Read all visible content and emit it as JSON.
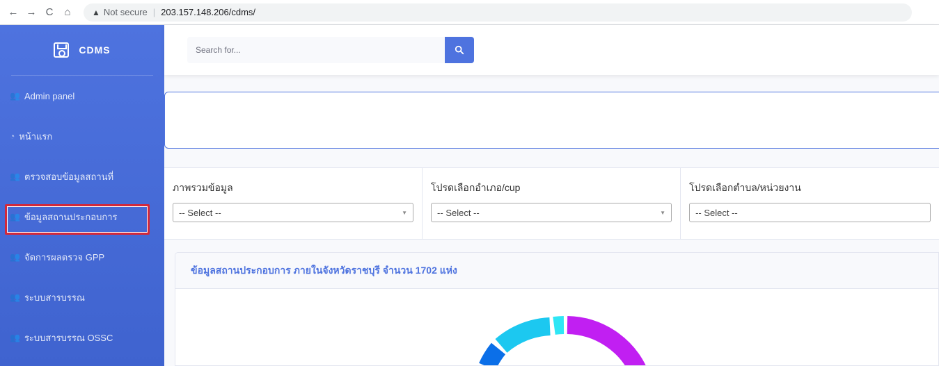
{
  "browser": {
    "security_label": "Not secure",
    "url": "203.157.148.206/cdms/"
  },
  "brand": {
    "name": "CDMS"
  },
  "sidebar": {
    "items": [
      {
        "label": "Admin panel",
        "icon": "users-icon"
      },
      {
        "label": "หน้าแรก",
        "icon": "tachometer-icon"
      },
      {
        "label": "ตรวจสอบข้อมูลสถานที่",
        "icon": "users-icon"
      },
      {
        "label": "ข้อมูลสถานประกอบการ",
        "icon": "users-icon"
      },
      {
        "label": "จัดการผลตรวจ GPP",
        "icon": "users-icon"
      },
      {
        "label": "ระบบสารบรรณ",
        "icon": "users-icon"
      },
      {
        "label": "ระบบสารบรรณ OSSC",
        "icon": "users-icon"
      }
    ]
  },
  "search": {
    "placeholder": "Search for..."
  },
  "filters": [
    {
      "label": "ภาพรวมข้อมูล",
      "selected": "-- Select --"
    },
    {
      "label": "โปรดเลือกอำเภอ/cup",
      "selected": "-- Select --"
    },
    {
      "label": "โปรดเลือกตำบล/หน่วยงาน",
      "selected": "-- Select --"
    }
  ],
  "card": {
    "title": "ข้อมูลสถานประกอบการ ภายในจังหวัดราชบุรี จำนวน 1702 แห่ง"
  },
  "colors": {
    "primary": "#4e73df",
    "highlight_box": "#d3283a",
    "donut": [
      "#c11ff2",
      "#1cc8f0",
      "#0b6fe8",
      "#2ee6f5"
    ]
  }
}
